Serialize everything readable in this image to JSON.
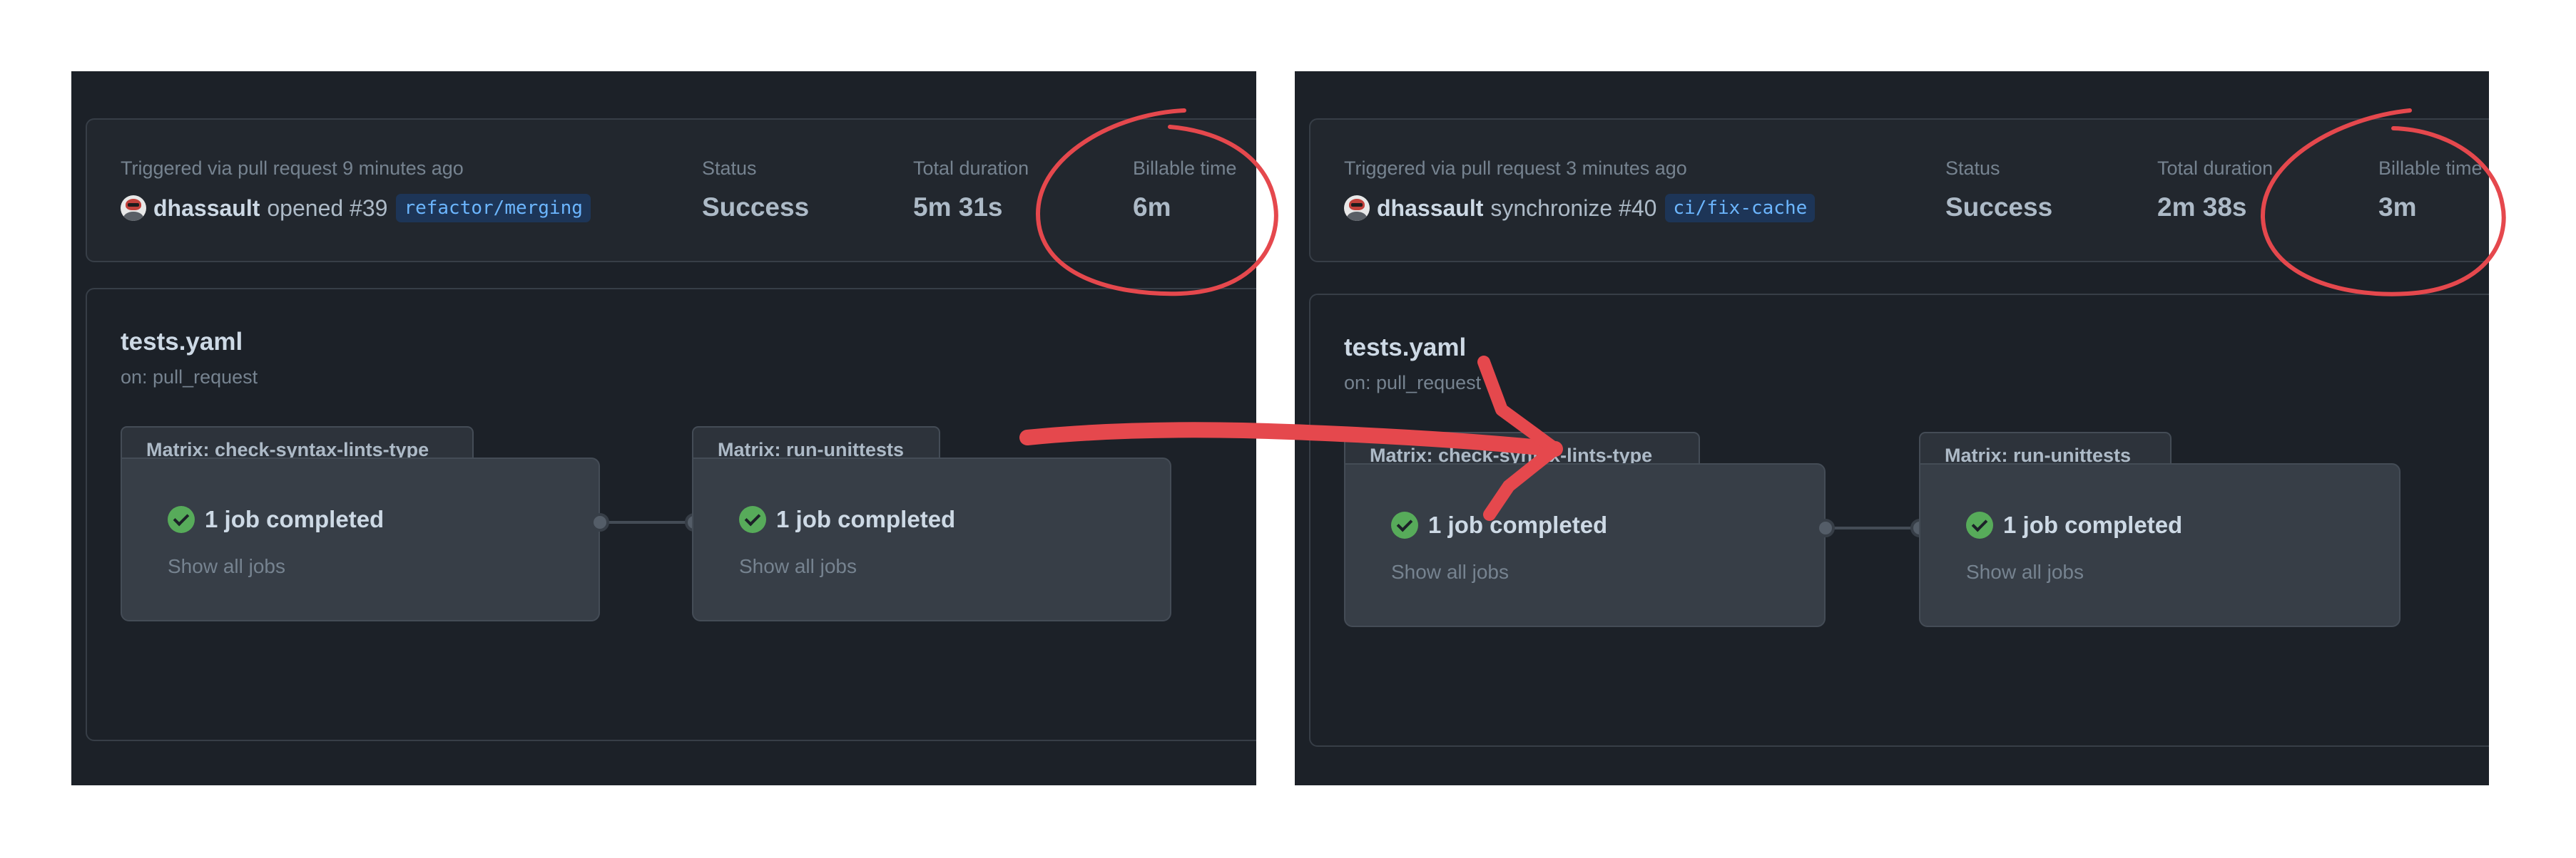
{
  "annotation_color": "#e5484d",
  "panels": [
    {
      "trigger_text": "Triggered via pull request 9 minutes ago",
      "actor": "dhassault",
      "event_action": "opened #39",
      "branch": "refactor/merging",
      "status_label": "Status",
      "status_value": "Success",
      "duration_label": "Total duration",
      "duration_value": "5m 31s",
      "billable_label": "Billable time",
      "billable_value": "6m",
      "workflow_title": "tests.yaml",
      "workflow_trigger": "on: pull_request",
      "matrices": [
        {
          "name": "Matrix: check-syntax-lints-type",
          "status": "1 job completed",
          "link": "Show all jobs"
        },
        {
          "name": "Matrix: run-unittests",
          "status": "1 job completed",
          "link": "Show all jobs"
        }
      ]
    },
    {
      "trigger_text": "Triggered via pull request 3 minutes ago",
      "actor": "dhassault",
      "event_action": "synchronize #40",
      "branch": "ci/fix-cache",
      "status_label": "Status",
      "status_value": "Success",
      "duration_label": "Total duration",
      "duration_value": "2m 38s",
      "billable_label": "Billable time",
      "billable_value": "3m",
      "workflow_title": "tests.yaml",
      "workflow_trigger": "on: pull_request",
      "matrices": [
        {
          "name": "Matrix: check-syntax-lints-type",
          "status": "1 job completed",
          "link": "Show all jobs"
        },
        {
          "name": "Matrix: run-unittests",
          "status": "1 job completed",
          "link": "Show all jobs"
        }
      ]
    }
  ]
}
